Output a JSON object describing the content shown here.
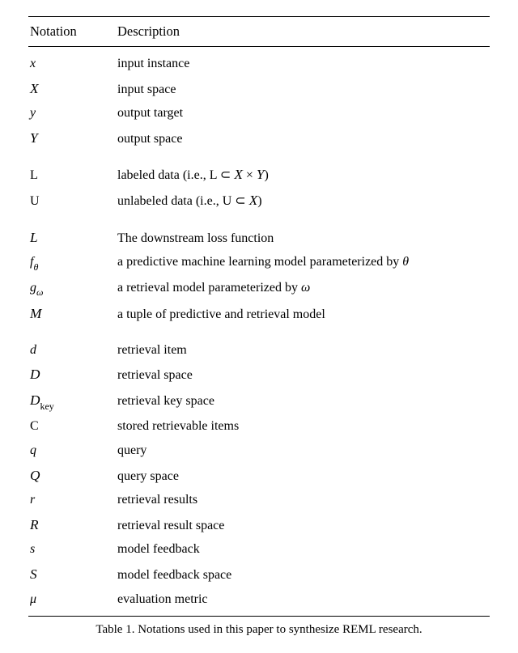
{
  "header": {
    "col1": "Notation",
    "col2": "Description"
  },
  "groups": [
    [
      {
        "notation": "<span class='mi'>x</span>",
        "description": "input instance"
      },
      {
        "notation": "<span class='cal'>X</span>",
        "description": "input space"
      },
      {
        "notation": "<span class='mi'>y</span>",
        "description": "output target"
      },
      {
        "notation": "<span class='cal'>Y</span>",
        "description": "output space"
      }
    ],
    [
      {
        "notation": "<span class='rm'>L</span>",
        "description": "labeled data (i.e., L ⊂ <span class='cal'>X</span> × <span class='cal'>Y</span>)"
      },
      {
        "notation": "<span class='rm'>U</span>",
        "description": "unlabeled data (i.e., U ⊂ <span class='cal'>X</span>)"
      }
    ],
    [
      {
        "notation": "<span class='cal'>L</span>",
        "description": "The downstream loss function"
      },
      {
        "notation": "<span class='mi'>f</span><span class='mi sub'>θ</span>",
        "description": "a predictive machine learning model parameterized by <span class='mi'>θ</span>"
      },
      {
        "notation": "<span class='mi'>g</span><span class='mi sub'>ω</span>",
        "description": "a retrieval model parameterized by <span class='mi'>ω</span>"
      },
      {
        "notation": "<span class='cal'>M</span>",
        "description": "a tuple of predictive and retrieval model"
      }
    ],
    [
      {
        "notation": "<span class='mi'>d</span>",
        "description": "retrieval item"
      },
      {
        "notation": "<span class='cal'>D</span>",
        "description": "retrieval space"
      },
      {
        "notation": "<span class='cal'>D</span><span class='rm sub'>key</span>",
        "description": "retrieval key space"
      },
      {
        "notation": "<span class='rm'>C</span>",
        "description": "stored retrievable items"
      },
      {
        "notation": "<span class='mi'>q</span>",
        "description": "query"
      },
      {
        "notation": "<span class='cal'>Q</span>",
        "description": "query space"
      },
      {
        "notation": "<span class='mi'>r</span>",
        "description": "retrieval results"
      },
      {
        "notation": "<span class='cal'>R</span>",
        "description": "retrieval result space"
      },
      {
        "notation": "<span class='mi'>s</span>",
        "description": "model feedback"
      },
      {
        "notation": "<span class='cal'>S</span>",
        "description": "model feedback space"
      },
      {
        "notation": "<span class='mi'>μ</span>",
        "description": "evaluation metric"
      }
    ]
  ],
  "caption": "Table 1.  Notations used in this paper to synthesize REML research."
}
